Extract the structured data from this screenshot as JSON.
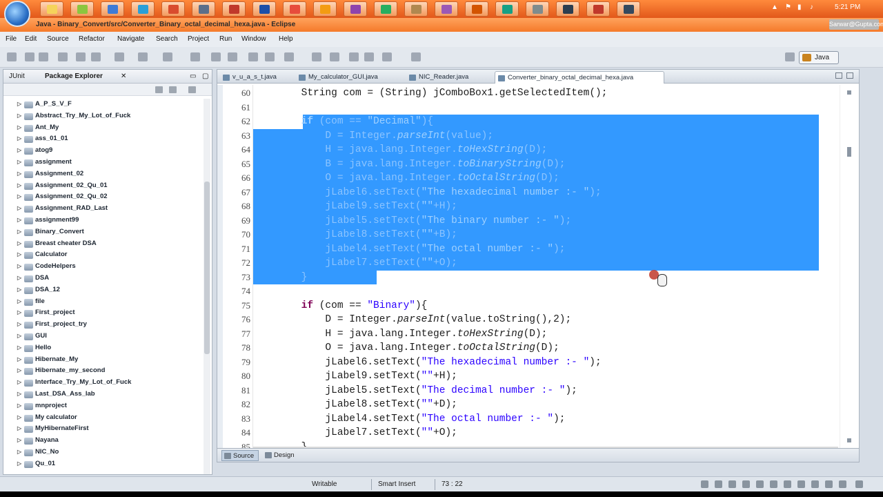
{
  "taskbar": {
    "clock": "5:21 PM"
  },
  "window": {
    "title": "Java - Binary_Convert/src/Converter_Binary_octal_decimal_hexa.java - Eclipse",
    "user_badge": "Sarwar@Gupta.com"
  },
  "menu": [
    "File",
    "Edit",
    "Source",
    "Refactor",
    "Navigate",
    "Search",
    "Project",
    "Run",
    "Window",
    "Help"
  ],
  "perspective": "Java",
  "left_panel": {
    "tabs": [
      "JUnit",
      "Package Explorer"
    ],
    "projects": [
      "A_P_S_V_F",
      "Abstract_Try_My_Lot_of_Fuck",
      "Ant_My",
      "ass_01_01",
      "atog9",
      "assignment",
      "Assignment_02",
      "Assignment_02_Qu_01",
      "Assignment_02_Qu_02",
      "Assignment_RAD_Last",
      "assignment99",
      "Binary_Convert",
      "Breast cheater DSA",
      "Calculator",
      "CodeHelpers",
      "DSA",
      "DSA_12",
      "file",
      "First_project",
      "First_project_try",
      "GUI",
      "Hello",
      "Hibernate_My",
      "Hibernate_my_second",
      "Interface_Try_My_Lot_of_Fuck",
      "Last_DSA_Ass_lab",
      "mnproject",
      "My calculator",
      "MyHibernateFirst",
      "Nayana",
      "NIC_No",
      "Qu_01"
    ]
  },
  "editor": {
    "tabs": [
      "v_u_a_s_t.java",
      "My_calculator_GUI.java",
      "NIC_Reader.java",
      "Converter_binary_octal_decimal_hexa.java"
    ],
    "active_tab": 3,
    "bottom_tabs": [
      "Source",
      "Design"
    ],
    "lines": [
      {
        "n": "60",
        "code": "        String com = (String) jComboBox1.getSelectedItem();"
      },
      {
        "n": "61",
        "code": ""
      },
      {
        "n": "62",
        "code": "        if (com == \"Decimal\"){"
      },
      {
        "n": "63",
        "code": "            D = Integer.parseInt(value);"
      },
      {
        "n": "64",
        "code": "            H = java.lang.Integer.toHexString(D);"
      },
      {
        "n": "65",
        "code": "            B = java.lang.Integer.toBinaryString(D);"
      },
      {
        "n": "66",
        "code": "            O = java.lang.Integer.toOctalString(D);"
      },
      {
        "n": "67",
        "code": "            jLabel6.setText(\"The hexadecimal number :- \");"
      },
      {
        "n": "68",
        "code": "            jLabel9.setText(\"\"+H);"
      },
      {
        "n": "69",
        "code": "            jLabel5.setText(\"The binary number :- \");"
      },
      {
        "n": "70",
        "code": "            jLabel8.setText(\"\"+B);"
      },
      {
        "n": "71",
        "code": "            jLabel4.setText(\"The octal number :- \");"
      },
      {
        "n": "72",
        "code": "            jLabel7.setText(\"\"+O);"
      },
      {
        "n": "73",
        "code": "        }"
      },
      {
        "n": "74",
        "code": ""
      },
      {
        "n": "75",
        "code": "        if (com == \"Binary\"){"
      },
      {
        "n": "76",
        "code": "            D = Integer.parseInt(value.toString(),2);"
      },
      {
        "n": "77",
        "code": "            H = java.lang.Integer.toHexString(D);"
      },
      {
        "n": "78",
        "code": "            O = java.lang.Integer.toOctalString(D);"
      },
      {
        "n": "79",
        "code": "            jLabel6.setText(\"The hexadecimal number :- \");"
      },
      {
        "n": "80",
        "code": "            jLabel9.setText(\"\"+H);"
      },
      {
        "n": "81",
        "code": "            jLabel5.setText(\"The decimal number :- \");"
      },
      {
        "n": "82",
        "code": "            jLabel8.setText(\"\"+D);"
      },
      {
        "n": "83",
        "code": "            jLabel4.setText(\"The octal number :- \");"
      },
      {
        "n": "84",
        "code": "            jLabel7.setText(\"\"+O);"
      },
      {
        "n": "85",
        "code": "        }"
      }
    ],
    "selected_lines": [
      "62",
      "63",
      "64",
      "65",
      "66",
      "67",
      "68",
      "69",
      "70",
      "71",
      "72",
      "73"
    ]
  },
  "status": {
    "mode": "Writable",
    "insert": "Smart Insert",
    "position": "73 : 22"
  }
}
